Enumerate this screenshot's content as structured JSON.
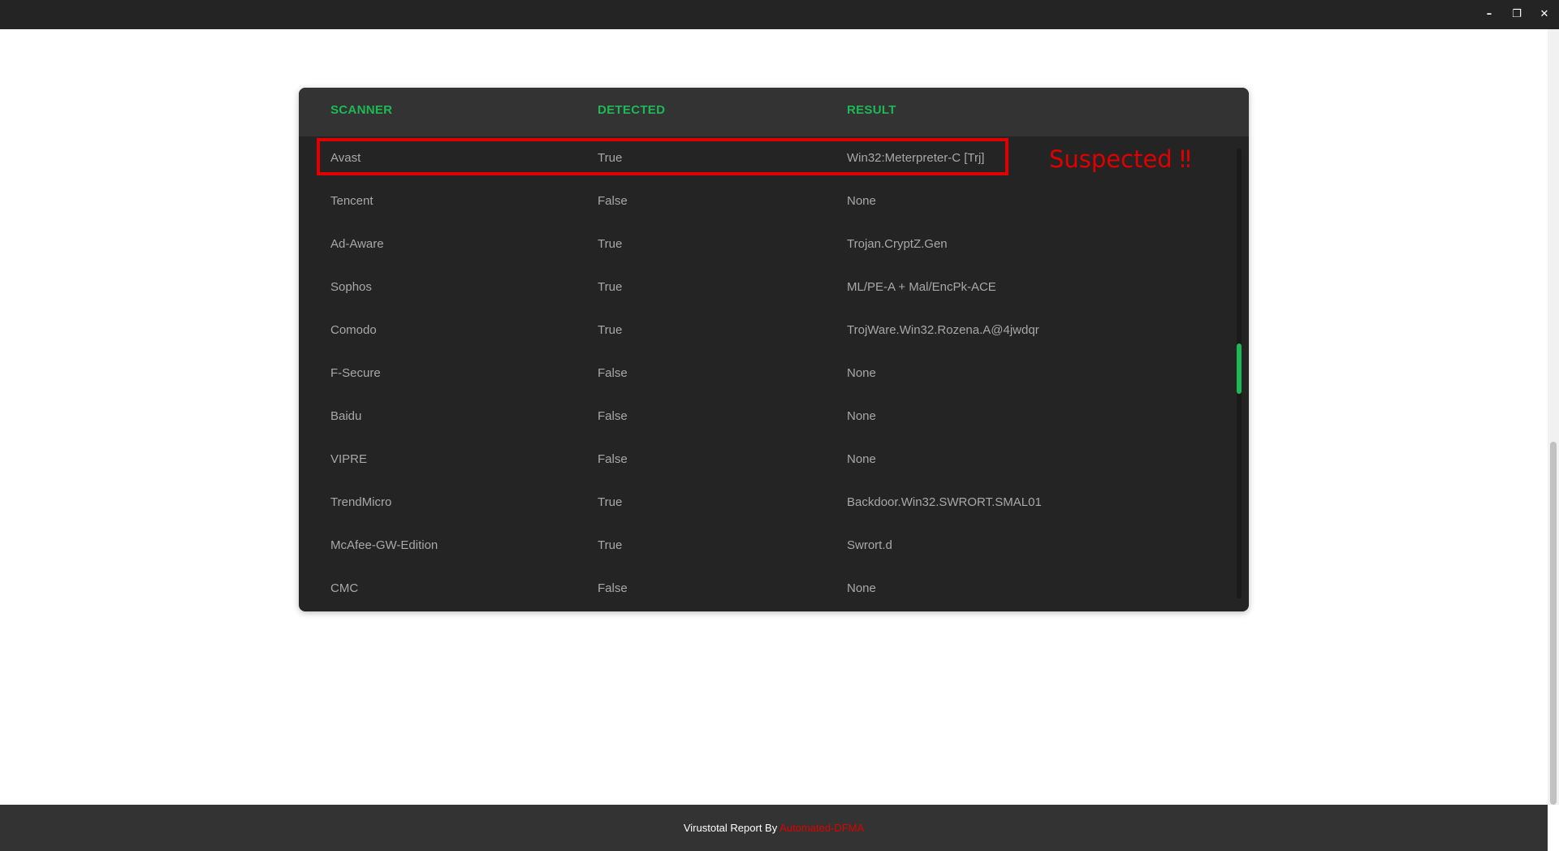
{
  "window": {
    "minimize_icon": "minimize-icon",
    "restore_icon": "restore-icon",
    "close_icon": "close-icon",
    "minimize_glyph": "–",
    "restore_glyph": "❐",
    "close_glyph": "✕"
  },
  "table": {
    "headers": {
      "scanner": "SCANNER",
      "detected": "DETECTED",
      "result": "RESULT"
    },
    "rows": [
      {
        "scanner": "Avast",
        "detected": "True",
        "result": "Win32:Meterpreter-C [Trj]"
      },
      {
        "scanner": "Tencent",
        "detected": "False",
        "result": "None"
      },
      {
        "scanner": "Ad-Aware",
        "detected": "True",
        "result": "Trojan.CryptZ.Gen"
      },
      {
        "scanner": "Sophos",
        "detected": "True",
        "result": "ML/PE-A + Mal/EncPk-ACE"
      },
      {
        "scanner": "Comodo",
        "detected": "True",
        "result": "TrojWare.Win32.Rozena.A@4jwdqr"
      },
      {
        "scanner": "F-Secure",
        "detected": "False",
        "result": "None"
      },
      {
        "scanner": "Baidu",
        "detected": "False",
        "result": "None"
      },
      {
        "scanner": "VIPRE",
        "detected": "False",
        "result": "None"
      },
      {
        "scanner": "TrendMicro",
        "detected": "True",
        "result": "Backdoor.Win32.SWRORT.SMAL01"
      },
      {
        "scanner": "McAfee-GW-Edition",
        "detected": "True",
        "result": "Swrort.d"
      },
      {
        "scanner": "CMC",
        "detected": "False",
        "result": "None"
      }
    ]
  },
  "annotation": {
    "label": "Suspected ‼",
    "color": "#e00000"
  },
  "footer": {
    "text": "Virustotal Report By ",
    "brand": "Automated-DFMA"
  },
  "colors": {
    "accent": "#1db954",
    "alert": "#e00000",
    "card_bg": "#242424",
    "header_bg": "#333333"
  }
}
